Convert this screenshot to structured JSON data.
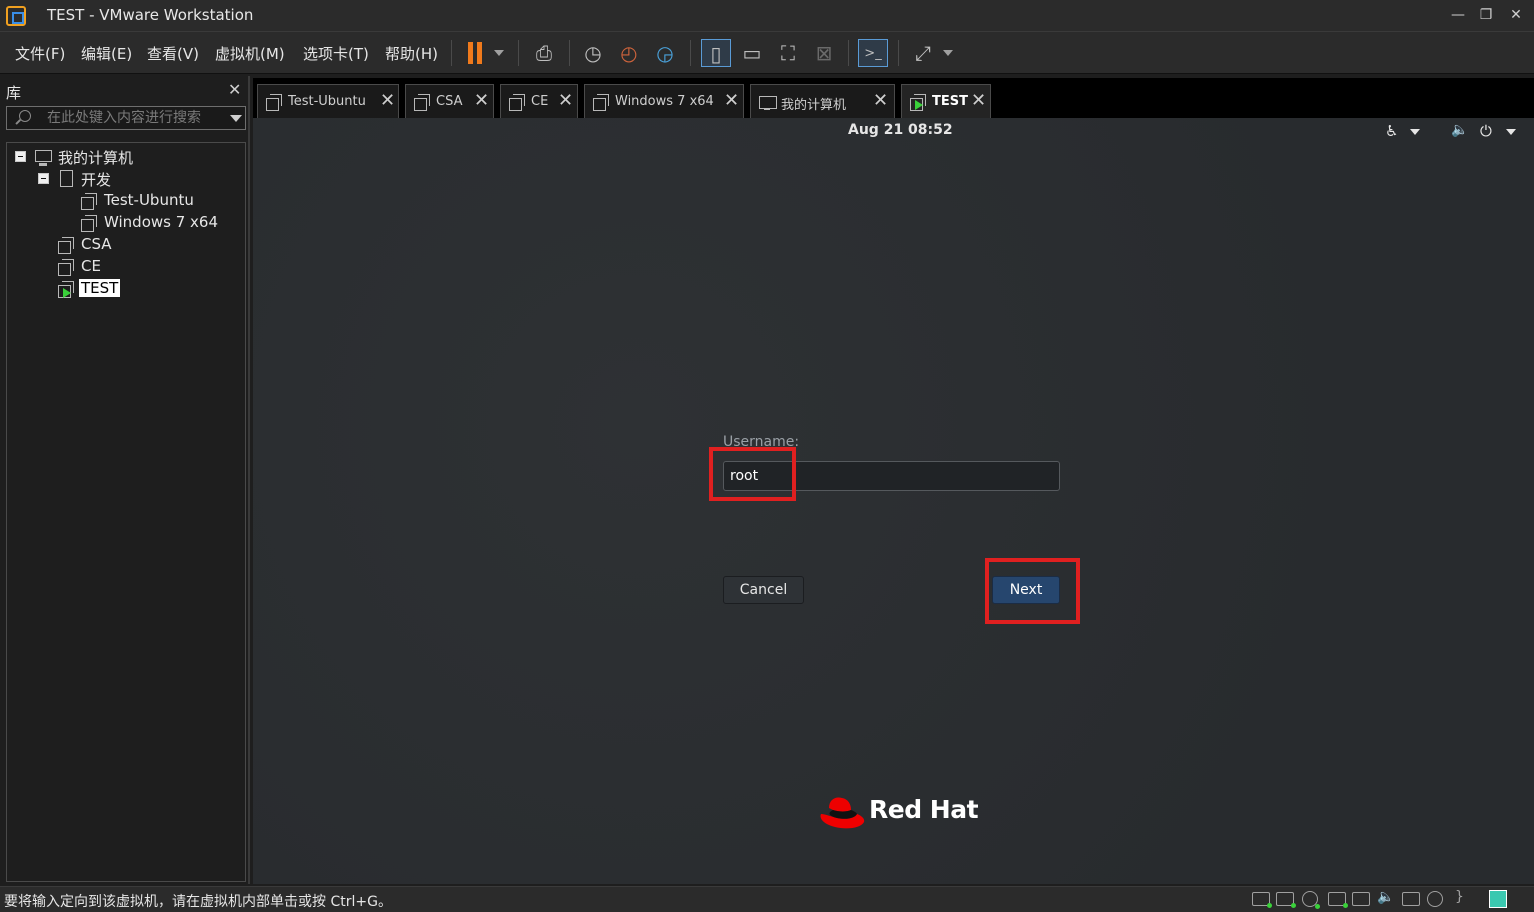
{
  "window": {
    "title": "TEST - VMware Workstation",
    "minimize": "—",
    "restore": "❐",
    "close": "✕"
  },
  "menu": {
    "items": [
      "文件(F)",
      "编辑(E)",
      "查看(V)",
      "虚拟机(M)",
      "选项卡(T)",
      "帮助(H)"
    ]
  },
  "toolbar": {
    "icons": [
      "pause-icon",
      "send-keys-icon",
      "snapshot-icon",
      "revert-snapshot-icon",
      "snapshot-manager-icon",
      "library-view-icon",
      "thumbnail-view-icon",
      "fullscreen-icon",
      "unity-icon",
      "console-icon",
      "stretch-icon"
    ]
  },
  "library": {
    "title": "库",
    "close": "✕",
    "search_placeholder": "在此处键入内容进行搜索",
    "tree": {
      "root": "我的计算机",
      "folder": "开发",
      "items": [
        "Test-Ubuntu",
        "Windows 7 x64",
        "CSA",
        "CE",
        "TEST"
      ],
      "selected": "TEST"
    }
  },
  "tabs": [
    {
      "label": "Test-Ubuntu",
      "icon": "vm-icon",
      "active": false
    },
    {
      "label": "CSA",
      "icon": "vm-icon",
      "active": false
    },
    {
      "label": "CE",
      "icon": "vm-icon",
      "active": false
    },
    {
      "label": "Windows 7 x64",
      "icon": "vm-icon",
      "active": false
    },
    {
      "label": "我的计算机",
      "icon": "computer-icon",
      "active": false
    },
    {
      "label": "TEST",
      "icon": "vm-running-icon",
      "active": true
    }
  ],
  "tab_close": "✕",
  "guest": {
    "clock": "Aug 21  08:52",
    "accessibility_icon": "♿",
    "volume_icon": "🔈",
    "power_icon": "⏻",
    "username_label": "Username:",
    "username_value": "root",
    "cancel_label": "Cancel",
    "next_label": "Next",
    "logo_text": "Red Hat",
    "highlight_color": "#e02020"
  },
  "status": {
    "message": "要将输入定向到该虚拟机，请在虚拟机内部单击或按 Ctrl+G。"
  },
  "colors": {
    "accent_pause": "#f07a1c",
    "next_button": "#26466e",
    "running_indicator": "#3ad13a"
  }
}
